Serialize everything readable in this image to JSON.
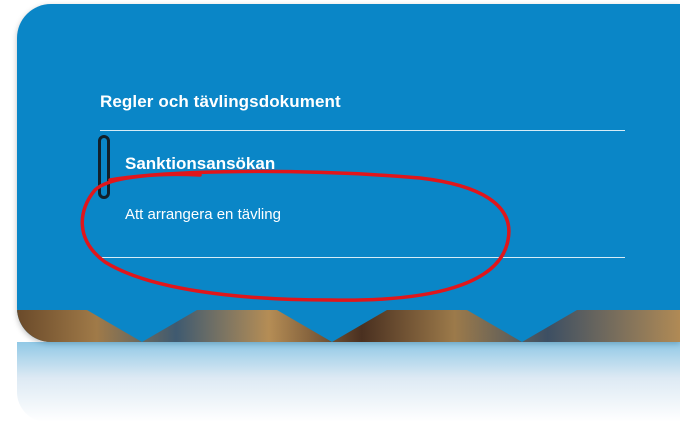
{
  "panel": {
    "heading": "Regler och tävlingsdokument",
    "links": [
      {
        "label": "Sanktionsansökan"
      },
      {
        "label": "Att arrangera en tävling"
      }
    ]
  },
  "colors": {
    "panel_background": "#0a86c7",
    "text": "#ffffff",
    "annotation_circle": "#e0161b"
  },
  "icons": {
    "focus_indicator": "keyboard-focus-ring"
  }
}
